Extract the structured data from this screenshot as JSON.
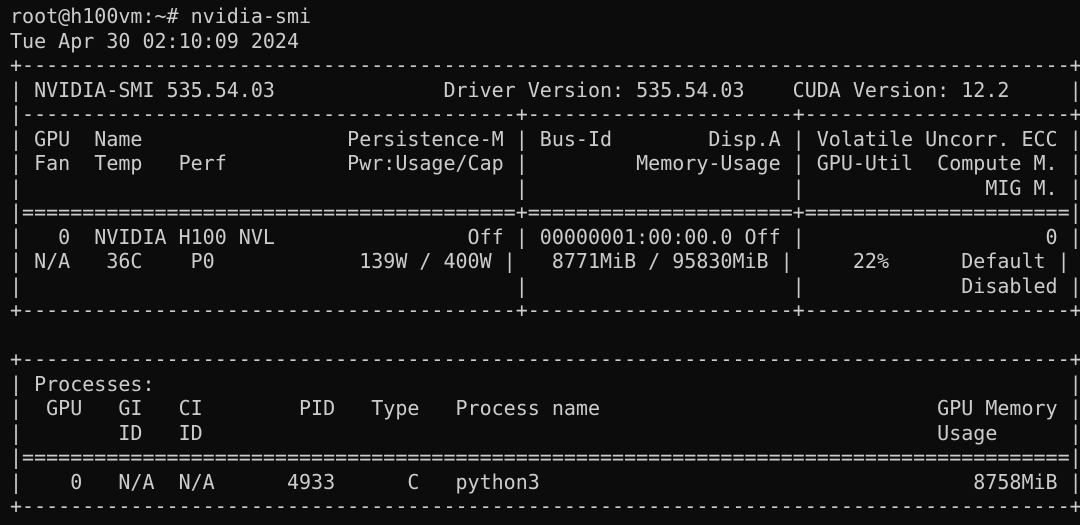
{
  "terminal": {
    "prompt": "root@h100vm:~# nvidia-smi",
    "timestamp": "Tue Apr 30 02:10:09 2024",
    "lines": [
      "+---------------------------------------------------------------------------------------+",
      "| NVIDIA-SMI 535.54.03              Driver Version: 535.54.03    CUDA Version: 12.2     |",
      "|-----------------------------------------+----------------------+----------------------+",
      "| GPU  Name                 Persistence-M | Bus-Id        Disp.A | Volatile Uncorr. ECC |",
      "| Fan  Temp   Perf          Pwr:Usage/Cap |         Memory-Usage | GPU-Util  Compute M. |",
      "|                                         |                      |               MIG M. |",
      "|=========================================+======================+======================|",
      "|   0  NVIDIA H100 NVL                Off | 00000001:00:00.0 Off |                    0 |",
      "| N/A   36C    P0            139W / 400W |   8771MiB / 95830MiB |     22%      Default |",
      "|                                         |                      |             Disabled |",
      "+-----------------------------------------+----------------------+----------------------+",
      "",
      "+---------------------------------------------------------------------------------------+",
      "| Processes:                                                                            |",
      "|  GPU   GI   CI        PID   Type   Process name                            GPU Memory |",
      "|        ID   ID                                                             Usage      |",
      "|=======================================================================================|",
      "|    0   N/A  N/A      4933      C   python3                                    8758MiB |",
      "+---------------------------------------------------------------------------------------+"
    ]
  }
}
